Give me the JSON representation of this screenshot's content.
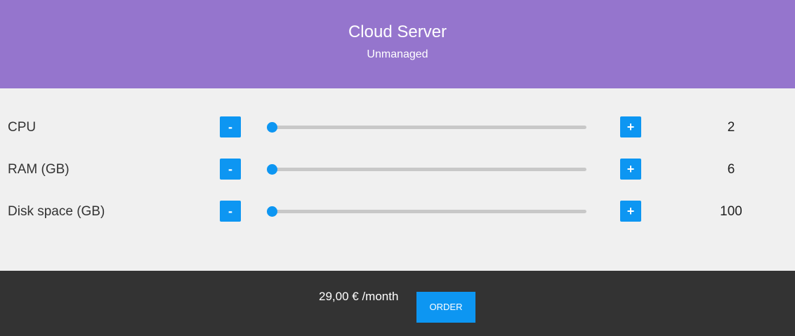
{
  "header": {
    "title": "Cloud Server",
    "subtitle": "Unmanaged"
  },
  "controls": {
    "minus_label": "-",
    "plus_label": "+",
    "rows": [
      {
        "label": "CPU",
        "value": "2",
        "slider_fraction": 0
      },
      {
        "label": "RAM (GB)",
        "value": "6",
        "slider_fraction": 0
      },
      {
        "label": "Disk space (GB)",
        "value": "100",
        "slider_fraction": 0
      }
    ]
  },
  "footer": {
    "price": "29,00 € /month",
    "order_label": "ORDER"
  },
  "colors": {
    "header_bg": "#9575cd",
    "accent": "#0d96f2",
    "footer_bg": "#333333",
    "body_bg": "#f0f0f0"
  }
}
